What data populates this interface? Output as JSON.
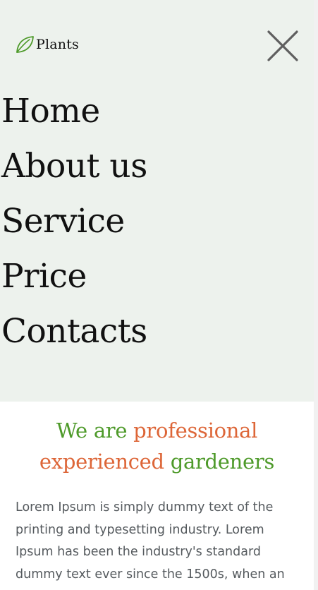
{
  "header": {
    "logo_text": "Plants",
    "logo_icon": "leaf-icon",
    "close_icon": "close-icon",
    "leaf_color": "#4e9a2a"
  },
  "nav": {
    "items": [
      {
        "label": "Home"
      },
      {
        "label": "About us"
      },
      {
        "label": "Service"
      },
      {
        "label": "Price"
      },
      {
        "label": "Contacts"
      }
    ]
  },
  "hero": {
    "headline_parts": [
      {
        "text": "We are ",
        "color": "#4e9a2a"
      },
      {
        "text": "professional experienced",
        "color": "#dd6638"
      },
      {
        "text": " gardeners",
        "color": "#4e9a2a"
      }
    ],
    "body": "Lorem Ipsum is simply dummy text of the printing and typesetting industry. Lorem Ipsum has been the industry's standard dummy text ever since the 1500s, when an"
  },
  "colors": {
    "menu_background": "#edf2ed",
    "accent_green": "#4e9a2a",
    "accent_orange": "#dd6638",
    "body_text": "#555a5e"
  }
}
